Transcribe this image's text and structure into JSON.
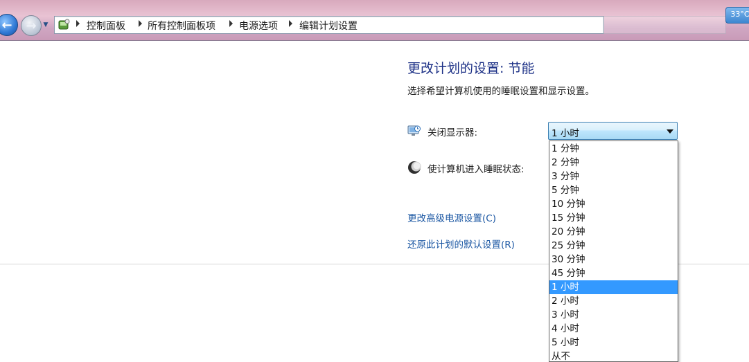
{
  "window": {
    "weather_badge": "33°C"
  },
  "breadcrumb": {
    "items": [
      "控制面板",
      "所有控制面板项",
      "电源选项",
      "编辑计划设置"
    ]
  },
  "main": {
    "title": "更改计划的设置: 节能",
    "subtitle": "选择希望计算机使用的睡眠设置和显示设置。",
    "settings": [
      {
        "label": "关闭显示器:",
        "icon": "monitor-icon",
        "value": "1 小时"
      },
      {
        "label": "使计算机进入睡眠状态:",
        "icon": "moon-icon"
      }
    ],
    "links": [
      "更改高级电源设置(C)",
      "还原此计划的默认设置(R)"
    ]
  },
  "dropdown": {
    "selected": "1 小时",
    "options": [
      "1 分钟",
      "2 分钟",
      "3 分钟",
      "5 分钟",
      "10 分钟",
      "15 分钟",
      "20 分钟",
      "25 分钟",
      "30 分钟",
      "45 分钟",
      "1 小时",
      "2 小时",
      "3 小时",
      "4 小时",
      "5 小时",
      "从不"
    ]
  },
  "colors": {
    "title": "#1e3287",
    "link": "#1e59a4",
    "selection": "#3399ff"
  }
}
